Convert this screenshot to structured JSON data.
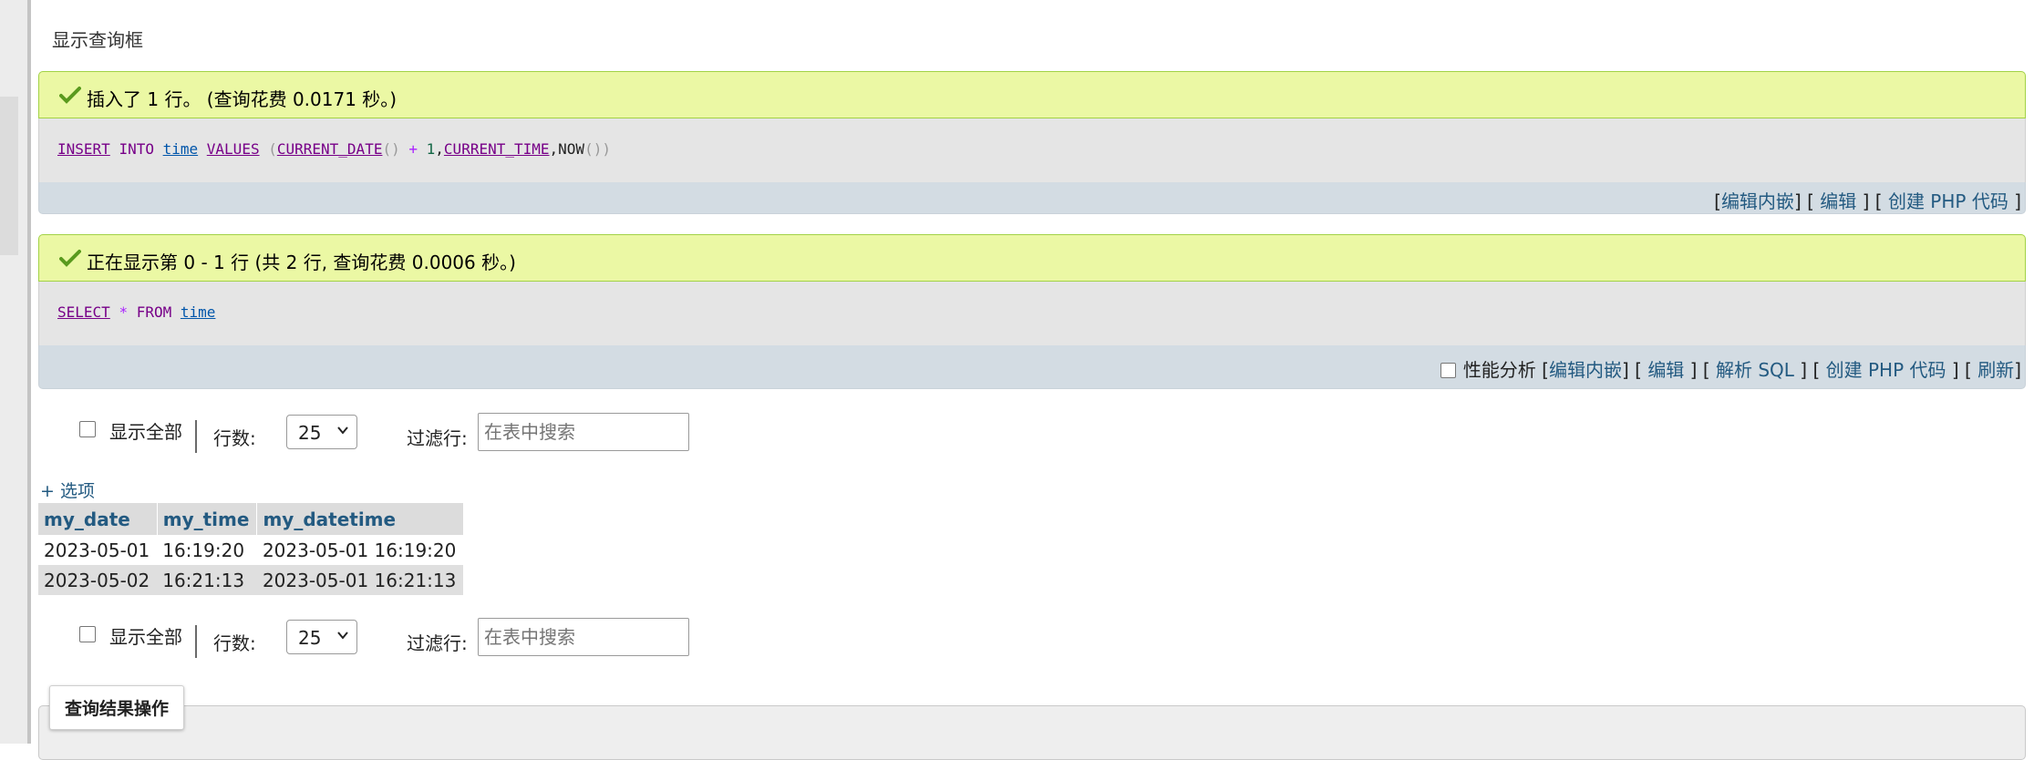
{
  "section_title": "显示查询框",
  "insert_result": {
    "message": "插入了 1 行。 (查询花费 0.0171 秒。)",
    "sql": {
      "insert": "INSERT",
      "into": "INTO",
      "table": "time",
      "values": "VALUES",
      "lparen": "(",
      "func1": "CURRENT_DATE",
      "func1_paren": "()",
      "plus": "+",
      "one": "1",
      "comma1": ",",
      "func2": "CURRENT_TIME",
      "comma2": ",",
      "func3": "NOW",
      "func3_paren": "()",
      "rparen": ")"
    },
    "links": {
      "open": "[",
      "edit_inline": "编辑内嵌",
      "sep1": "] [",
      "edit": "编辑",
      "sep2": "] [",
      "create_php": "创建 PHP 代码",
      "close": "]"
    }
  },
  "select_result": {
    "message": "正在显示第 0 - 1 行 (共 2 行, 查询花费 0.0006 秒。)",
    "sql": {
      "select": "SELECT",
      "star": "*",
      "from": "FROM",
      "table": "time"
    },
    "links": {
      "profiling": "性能分析",
      "open": "[",
      "edit_inline": "编辑内嵌",
      "sep1": "] [",
      "edit": "编辑",
      "sep2": "] [",
      "explain": "解析 SQL",
      "sep3": "] [",
      "create_php": "创建 PHP 代码",
      "sep4": "] [",
      "refresh": "刷新",
      "close": "]"
    }
  },
  "nav": {
    "show_all": "显示全部",
    "rows_label": "行数:",
    "rows_value": "25",
    "filter_label": "过滤行:",
    "filter_placeholder": "在表中搜索"
  },
  "options_link": "+ 选项",
  "table": {
    "columns": [
      "my_date",
      "my_time",
      "my_datetime"
    ],
    "rows": [
      [
        "2023-05-01",
        "16:19:20",
        "2023-05-01 16:19:20"
      ],
      [
        "2023-05-02",
        "16:21:13",
        "2023-05-01 16:21:13"
      ]
    ]
  },
  "query_ops_button": "查询结果操作",
  "colors": {
    "success_bg": "#ebf8a4",
    "link": "#235a81",
    "sql_keyword": "#770088"
  }
}
